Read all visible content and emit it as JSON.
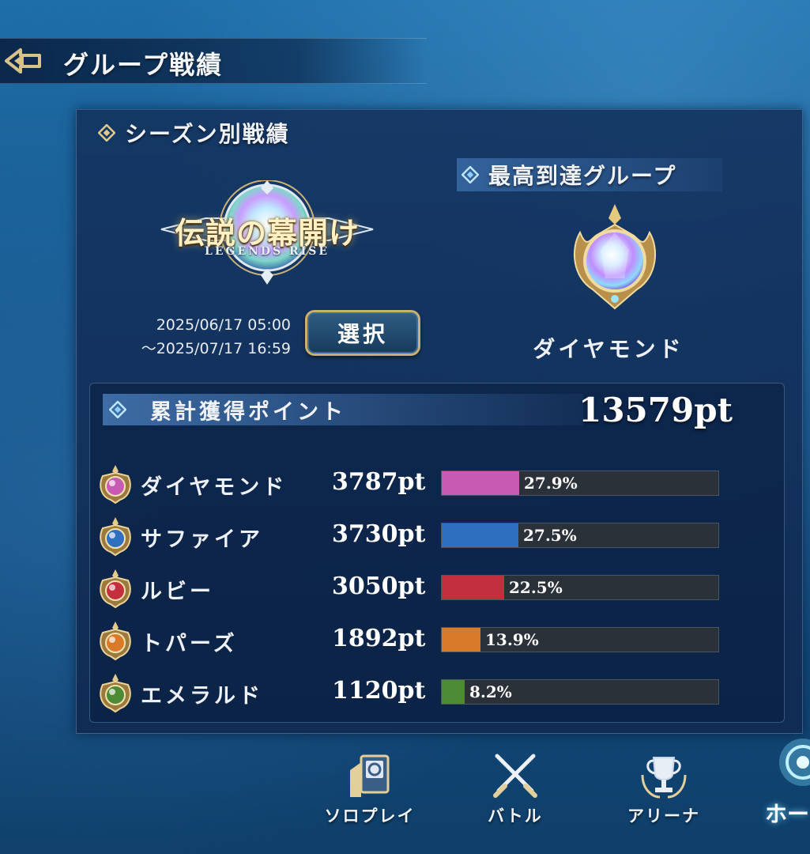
{
  "header": {
    "title": "グループ戦績"
  },
  "season_section": {
    "title": "シーズン別戦績",
    "season_logo_text": "伝説の幕開け",
    "season_logo_subtitle": "LEGENDS RISE",
    "period_start": "2025/06/17 05:00",
    "period_end": "～2025/07/17 16:59",
    "select_label": "選択"
  },
  "best_group": {
    "title": "最高到達グループ",
    "name": "ダイヤモンド"
  },
  "points": {
    "title": "累計獲得ポイント",
    "total": "13579pt",
    "rows": [
      {
        "name": "ダイヤモンド",
        "points": "3787pt",
        "percent_label": "27.9%",
        "share": 0.279,
        "color": "#c75bb3",
        "icon": "diamond-gem-icon"
      },
      {
        "name": "サファイア",
        "points": "3730pt",
        "percent_label": "27.5%",
        "share": 0.275,
        "color": "#2f6fbf",
        "icon": "sapphire-gem-icon"
      },
      {
        "name": "ルビー",
        "points": "3050pt",
        "percent_label": "22.5%",
        "share": 0.225,
        "color": "#c32f3c",
        "icon": "ruby-gem-icon"
      },
      {
        "name": "トパーズ",
        "points": "1892pt",
        "percent_label": "13.9%",
        "share": 0.139,
        "color": "#d97a2b",
        "icon": "topaz-gem-icon"
      },
      {
        "name": "エメラルド",
        "points": "1120pt",
        "percent_label": "8.2%",
        "share": 0.082,
        "color": "#4d8a34",
        "icon": "emerald-gem-icon"
      }
    ]
  },
  "nav": {
    "solo_play": "ソロプレイ",
    "battle": "バトル",
    "arena": "アリーナ",
    "home": "ホー"
  }
}
